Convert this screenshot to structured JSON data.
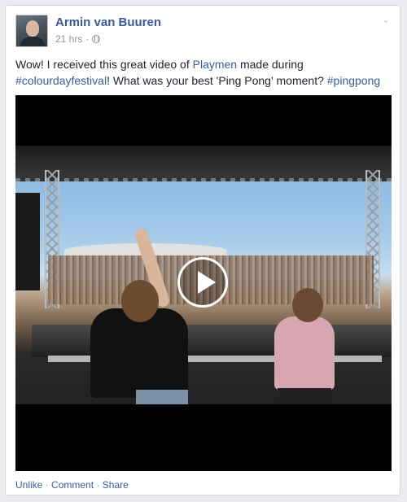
{
  "post": {
    "author": "Armin van Buuren",
    "timestamp": "21 hrs",
    "timestamp_sep": " · ",
    "text_1": "Wow! I received this great video of ",
    "mention": "Playmen",
    "text_2": " made during ",
    "hashtag_1": "#colourdayfestival",
    "text_3": "! What was your best 'Ping Pong' moment? ",
    "hashtag_2": "#pingpong"
  },
  "actions": {
    "unlike": "Unlike",
    "comment": "Comment",
    "share": "Share",
    "sep": " · "
  },
  "icons": {
    "privacy": "globe-icon",
    "menu": "chevron-down-icon",
    "play": "play-icon"
  },
  "colors": {
    "link": "#3b5998",
    "meta": "#90949c",
    "text": "#1d2129",
    "background": "#e9ebee"
  }
}
